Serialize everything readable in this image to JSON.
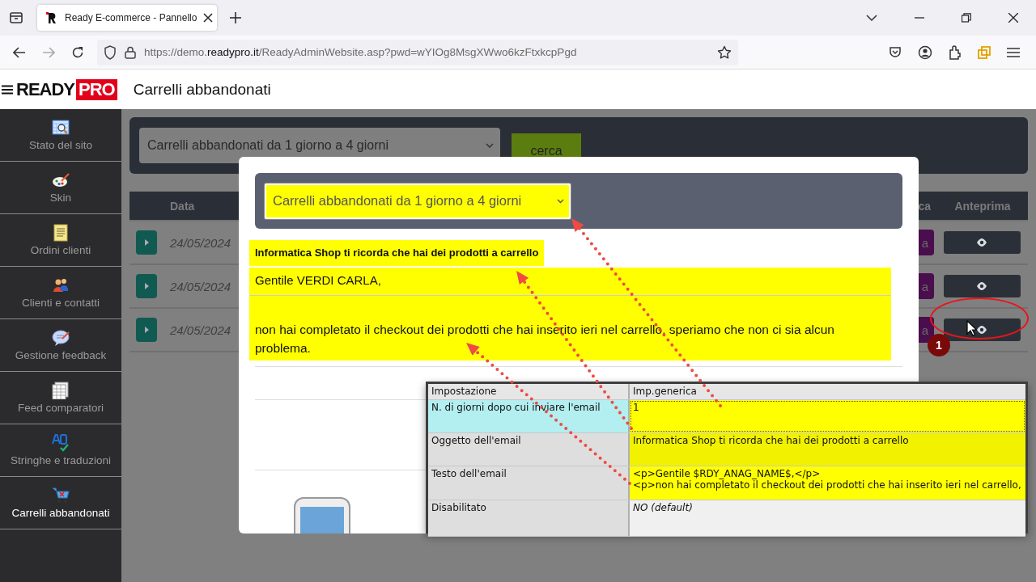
{
  "browser": {
    "tab_title": "Ready E-commerce - Pannello",
    "url": "https://demo.**readypro.it**/ReadyAdminWebsite.asp?pwd=wYIOg8MsgXWwo6kzFtxkcpPgd"
  },
  "app": {
    "logo_word": "READY",
    "logo_badge": "PRO",
    "page_title": "Carrelli abbandonati"
  },
  "sidebar": {
    "items": [
      {
        "label": "Stato del sito",
        "kind": "monitor",
        "selected": false
      },
      {
        "label": "Skin",
        "kind": "palette",
        "selected": false
      },
      {
        "label": "Ordini clienti",
        "kind": "document",
        "selected": false
      },
      {
        "label": "Clienti e contatti",
        "kind": "people",
        "selected": false
      },
      {
        "label": "Gestione feedback",
        "kind": "speech",
        "selected": false
      },
      {
        "label": "Feed comparatori",
        "kind": "grid",
        "selected": false
      },
      {
        "label": "Stringhe e traduzioni",
        "kind": "spell",
        "selected": false
      },
      {
        "label": "Carrelli abbandonati",
        "kind": "cart",
        "selected": true
      }
    ]
  },
  "filter": {
    "value": "Carrelli abbandonati da 1 giorno a 4 giorni",
    "button": "cerca"
  },
  "table": {
    "columns": [
      "Data",
      "ca",
      "Anteprima"
    ],
    "rows": [
      {
        "date": "24/05/2024",
        "column_2": "a",
        "annotated": false
      },
      {
        "date": "24/05/2024",
        "column_2": "a",
        "annotated": false
      },
      {
        "date": "24/05/2024",
        "column_2": "a",
        "annotated": true
      }
    ]
  },
  "modal": {
    "select_value": "Carrelli abbandonati da 1 giorno a 4 giorni",
    "subject": "Informatica Shop ti ricorda che hai dei prodotti a carrello",
    "greeting": "Gentile VERDI CARLA,",
    "body": "non hai completato il checkout dei prodotti che hai inserito ieri nel carrello, speriamo che non ci sia alcun problema."
  },
  "settings_window": {
    "columns": [
      "Impostazione",
      "Imp.generica"
    ],
    "rows": [
      {
        "setting": "N. di giorni dopo cui inviare l'email",
        "value_lines": [
          "1"
        ],
        "selected": true,
        "highlighted": true,
        "is_default": false
      },
      {
        "setting": "Oggetto dell'email",
        "value_lines": [
          "Informatica Shop ti ricorda che hai dei prodotti a carrello"
        ],
        "selected": false,
        "highlighted": true,
        "is_default": false
      },
      {
        "setting": "Testo dell'email",
        "value_lines": [
          "<p>Gentile $RDY_ANAG_NAME$,</p>",
          "<p>non hai completato il checkout dei prodotti che hai inserito ieri nel carrello,"
        ],
        "selected": false,
        "highlighted": true,
        "is_default": false
      },
      {
        "setting": "Disabilitato",
        "value_lines": [
          "NO (default)"
        ],
        "selected": false,
        "highlighted": false,
        "is_default": true
      }
    ]
  },
  "annotation": {
    "badge": "1"
  }
}
